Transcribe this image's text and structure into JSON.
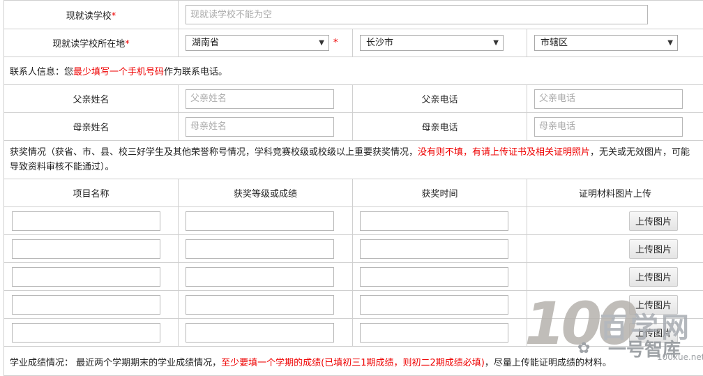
{
  "school": {
    "label": "现就读学校",
    "placeholder": "现就读学校不能为空"
  },
  "location": {
    "label": "现就读学校所在地",
    "province": "湖南省",
    "city": "长沙市",
    "district": "市辖区"
  },
  "contact": {
    "prefix": "联系人信息：您",
    "highlight": "最少填写一个手机号码",
    "suffix": "作为联系电话。",
    "father_name_label": "父亲姓名",
    "father_name_placeholder": "父亲姓名",
    "father_phone_label": "父亲电话",
    "father_phone_placeholder": "父亲电话",
    "mother_name_label": "母亲姓名",
    "mother_name_placeholder": "母亲姓名",
    "mother_phone_label": "母亲电话",
    "mother_phone_placeholder": "母亲电话"
  },
  "awards": {
    "intro_prefix": "获奖情况（获省、市、县、校三好学生及其他荣誉称号情况，学科竞赛校级或校级以上重要获奖情况，",
    "intro_highlight": "没有则不填，有请上传证书及相关证明照片",
    "intro_suffix": "，无关或无效图片，可能导致资料审核不能通过）。",
    "headers": [
      "项目名称",
      "获奖等级或成绩",
      "获奖时间",
      "证明材料图片上传"
    ],
    "upload_label": "上传图片",
    "rows": [
      {},
      {},
      {},
      {},
      {}
    ]
  },
  "grades": {
    "prefix": "学业成绩情况： 最近两个学期期末的学业成绩情况，",
    "highlight": "至少要填一个学期的成绩(已填初三1期成绩，则初二2期成绩必填)",
    "suffix": "，尽量上传能证明成绩的材料。"
  },
  "watermark": {
    "number": "100",
    "name": "百学网",
    "sub": "一号智库",
    "url": "100xue.net"
  },
  "colors": {
    "required": "#e00000",
    "border": "#cfcfcf"
  }
}
